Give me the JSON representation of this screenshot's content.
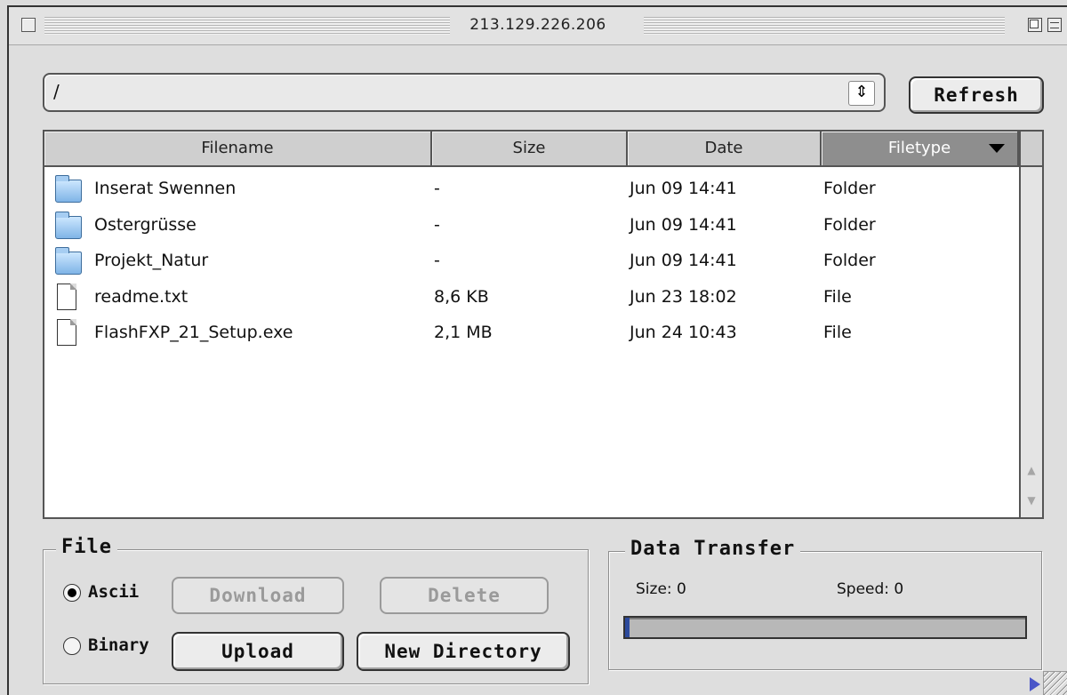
{
  "window": {
    "title": "213.129.226.206"
  },
  "path": {
    "value": "/"
  },
  "toolbar": {
    "refresh_label": "Refresh"
  },
  "list": {
    "columns": [
      "Filename",
      "Size",
      "Date",
      "Filetype"
    ],
    "sorted_column": "Filetype",
    "rows": [
      {
        "icon": "folder-icon",
        "name": "Inserat Swennen",
        "size": "-",
        "date": "Jun 09 14:41",
        "type": "Folder"
      },
      {
        "icon": "folder-icon",
        "name": "Ostergrüsse",
        "size": "-",
        "date": "Jun 09 14:41",
        "type": "Folder"
      },
      {
        "icon": "folder-icon",
        "name": "Projekt_Natur",
        "size": "-",
        "date": "Jun 09 14:41",
        "type": "Folder"
      },
      {
        "icon": "document-icon",
        "name": "readme.txt",
        "size": "8,6 KB",
        "date": "Jun 23 18:02",
        "type": "File"
      },
      {
        "icon": "document-icon",
        "name": "FlashFXP_21_Setup.exe",
        "size": "2,1 MB",
        "date": "Jun 24 10:43",
        "type": "File"
      }
    ]
  },
  "file_group": {
    "title": "File",
    "mode_ascii": "Ascii",
    "mode_binary": "Binary",
    "selected_mode": "Ascii",
    "download_label": "Download",
    "delete_label": "Delete",
    "upload_label": "Upload",
    "new_directory_label": "New Directory"
  },
  "transfer_group": {
    "title": "Data Transfer",
    "size_text": "Size: 0",
    "speed_text": "Speed: 0",
    "progress": 0.01
  },
  "colors": {
    "progress_fill": "#2c4a9c",
    "sorted_header": "#8e8e8e"
  }
}
